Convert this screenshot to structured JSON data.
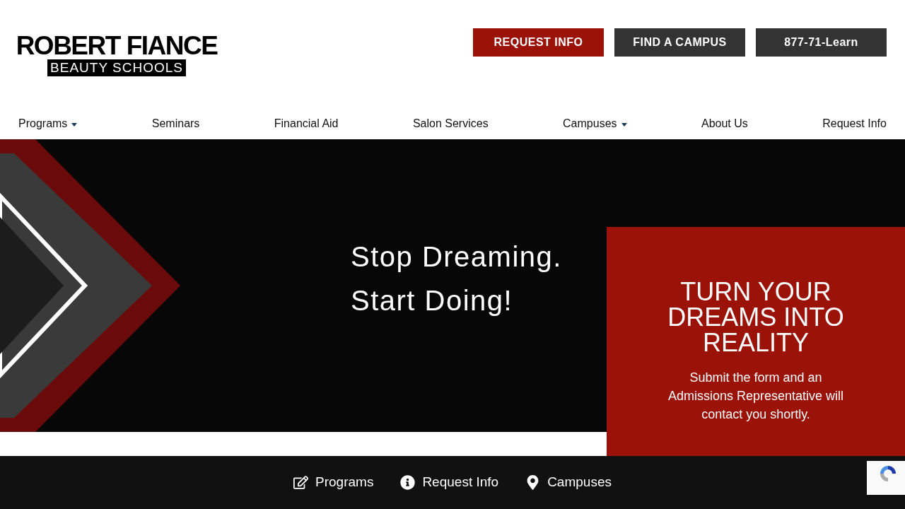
{
  "logo": {
    "title": "ROBERT FIANCE",
    "subtitle": "BEAUTY SCHOOLS"
  },
  "header_buttons": [
    {
      "label": "REQUEST INFO",
      "kind": "primary"
    },
    {
      "label": "FIND A CAMPUS",
      "kind": "dark"
    },
    {
      "label": "877-71-Learn",
      "kind": "dark"
    }
  ],
  "nav": [
    {
      "label": "Programs",
      "dropdown": true
    },
    {
      "label": "Seminars",
      "dropdown": false
    },
    {
      "label": "Financial Aid",
      "dropdown": false
    },
    {
      "label": "Salon Services",
      "dropdown": false
    },
    {
      "label": "Campuses",
      "dropdown": true
    },
    {
      "label": "About Us",
      "dropdown": false
    },
    {
      "label": "Request Info",
      "dropdown": false
    }
  ],
  "hero": {
    "lines": [
      "Stop Dreaming.",
      "Start Doing!"
    ]
  },
  "panel": {
    "title": "TURN YOUR DREAMS INTO REALITY",
    "text": "Submit the form and an Admissions Representative will contact you shortly."
  },
  "bottom_bar": [
    {
      "label": "Programs",
      "kind": "edit"
    },
    {
      "label": "Request Info",
      "kind": "info"
    },
    {
      "label": "Campuses",
      "kind": "pin"
    }
  ]
}
